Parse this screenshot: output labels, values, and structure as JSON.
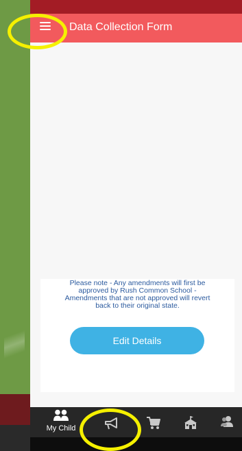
{
  "header": {
    "title": "Data Collection Form",
    "menu_icon": "hamburger-menu-icon",
    "background_color": "#f25a5d",
    "status_bar_color": "#a31c25"
  },
  "notice": {
    "lines": [
      "Please note - Any amendments will first be",
      "approved by Rush Common School -",
      "Amendments that are not approved will revert",
      "back to their original state."
    ],
    "text_color": "#2b5a9e"
  },
  "edit_button": {
    "label": "Edit Details",
    "color": "#3fb2e4"
  },
  "tabbar": {
    "items": [
      {
        "label": "My Child",
        "icon": "children-icon"
      },
      {
        "label": "",
        "icon": "megaphone-icon"
      },
      {
        "label": "",
        "icon": "shopping-cart-icon"
      },
      {
        "label": "",
        "icon": "school-building-icon"
      },
      {
        "label": "",
        "icon": "contacts-icon"
      }
    ]
  },
  "highlight_color": "#f5f000"
}
